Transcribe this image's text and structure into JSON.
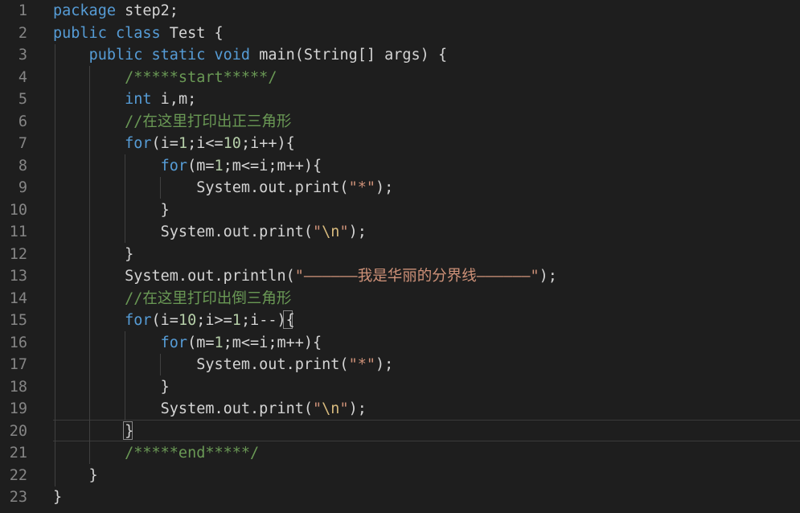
{
  "colors": {
    "background": "#1e1e1e",
    "keyword": "#569cd6",
    "number": "#b5cea8",
    "string": "#ce9178",
    "comment": "#6a9955",
    "text": "#d4d4d4",
    "line_number": "#858585"
  },
  "lines": [
    {
      "n": "1",
      "tokens": [
        [
          "kw",
          "package"
        ],
        [
          "plain",
          " step2;"
        ]
      ]
    },
    {
      "n": "2",
      "tokens": [
        [
          "kw",
          "public"
        ],
        [
          "plain",
          " "
        ],
        [
          "kw",
          "class"
        ],
        [
          "plain",
          " Test {"
        ]
      ]
    },
    {
      "n": "3",
      "tokens": [
        [
          "plain",
          "    "
        ],
        [
          "kw",
          "public"
        ],
        [
          "plain",
          " "
        ],
        [
          "kw",
          "static"
        ],
        [
          "plain",
          " "
        ],
        [
          "kw",
          "void"
        ],
        [
          "plain",
          " main(String[] args) {"
        ]
      ]
    },
    {
      "n": "4",
      "tokens": [
        [
          "plain",
          "        "
        ],
        [
          "cmt",
          "/*****start*****/"
        ]
      ]
    },
    {
      "n": "5",
      "tokens": [
        [
          "plain",
          "        "
        ],
        [
          "kw",
          "int"
        ],
        [
          "plain",
          " i,m;"
        ]
      ]
    },
    {
      "n": "6",
      "tokens": [
        [
          "plain",
          "        "
        ],
        [
          "cmt",
          "//在这里打印出正三角形"
        ]
      ]
    },
    {
      "n": "7",
      "tokens": [
        [
          "plain",
          "        "
        ],
        [
          "kw",
          "for"
        ],
        [
          "plain",
          "(i="
        ],
        [
          "num",
          "1"
        ],
        [
          "plain",
          ";i<="
        ],
        [
          "num",
          "10"
        ],
        [
          "plain",
          ";i++){"
        ]
      ]
    },
    {
      "n": "8",
      "tokens": [
        [
          "plain",
          "            "
        ],
        [
          "kw",
          "for"
        ],
        [
          "plain",
          "(m="
        ],
        [
          "num",
          "1"
        ],
        [
          "plain",
          ";m<=i;m++){"
        ]
      ]
    },
    {
      "n": "9",
      "tokens": [
        [
          "plain",
          "                System.out.print("
        ],
        [
          "str",
          "\"*\""
        ],
        [
          "plain",
          ");"
        ]
      ]
    },
    {
      "n": "10",
      "tokens": [
        [
          "plain",
          "            }"
        ]
      ]
    },
    {
      "n": "11",
      "tokens": [
        [
          "plain",
          "            System.out.print("
        ],
        [
          "str",
          "\""
        ],
        [
          "esc",
          "\\n"
        ],
        [
          "str",
          "\""
        ],
        [
          "plain",
          ");"
        ]
      ]
    },
    {
      "n": "12",
      "tokens": [
        [
          "plain",
          "        }"
        ]
      ]
    },
    {
      "n": "13",
      "tokens": [
        [
          "plain",
          "        System.out.println("
        ],
        [
          "str",
          "\"——————我是华丽的分界线——————\""
        ],
        [
          "plain",
          ");"
        ]
      ]
    },
    {
      "n": "14",
      "tokens": [
        [
          "plain",
          "        "
        ],
        [
          "cmt",
          "//在这里打印出倒三角形"
        ]
      ]
    },
    {
      "n": "15",
      "tokens": [
        [
          "plain",
          "        "
        ],
        [
          "kw",
          "for"
        ],
        [
          "plain",
          "(i="
        ],
        [
          "num",
          "10"
        ],
        [
          "plain",
          ";i>="
        ],
        [
          "num",
          "1"
        ],
        [
          "plain",
          ";i--){"
        ]
      ]
    },
    {
      "n": "16",
      "tokens": [
        [
          "plain",
          "            "
        ],
        [
          "kw",
          "for"
        ],
        [
          "plain",
          "(m="
        ],
        [
          "num",
          "1"
        ],
        [
          "plain",
          ";m<=i;m++){"
        ]
      ]
    },
    {
      "n": "17",
      "tokens": [
        [
          "plain",
          "                System.out.print("
        ],
        [
          "str",
          "\"*\""
        ],
        [
          "plain",
          ");"
        ]
      ]
    },
    {
      "n": "18",
      "tokens": [
        [
          "plain",
          "            }"
        ]
      ]
    },
    {
      "n": "19",
      "tokens": [
        [
          "plain",
          "            System.out.print("
        ],
        [
          "str",
          "\""
        ],
        [
          "esc",
          "\\n"
        ],
        [
          "str",
          "\""
        ],
        [
          "plain",
          ");"
        ]
      ]
    },
    {
      "n": "20",
      "tokens": [
        [
          "plain",
          "        }"
        ]
      ]
    },
    {
      "n": "21",
      "tokens": [
        [
          "plain",
          "        "
        ],
        [
          "cmt",
          "/*****end*****/"
        ]
      ]
    },
    {
      "n": "22",
      "tokens": [
        [
          "plain",
          "    }"
        ]
      ]
    },
    {
      "n": "23",
      "tokens": [
        [
          "plain",
          "}"
        ]
      ]
    }
  ]
}
